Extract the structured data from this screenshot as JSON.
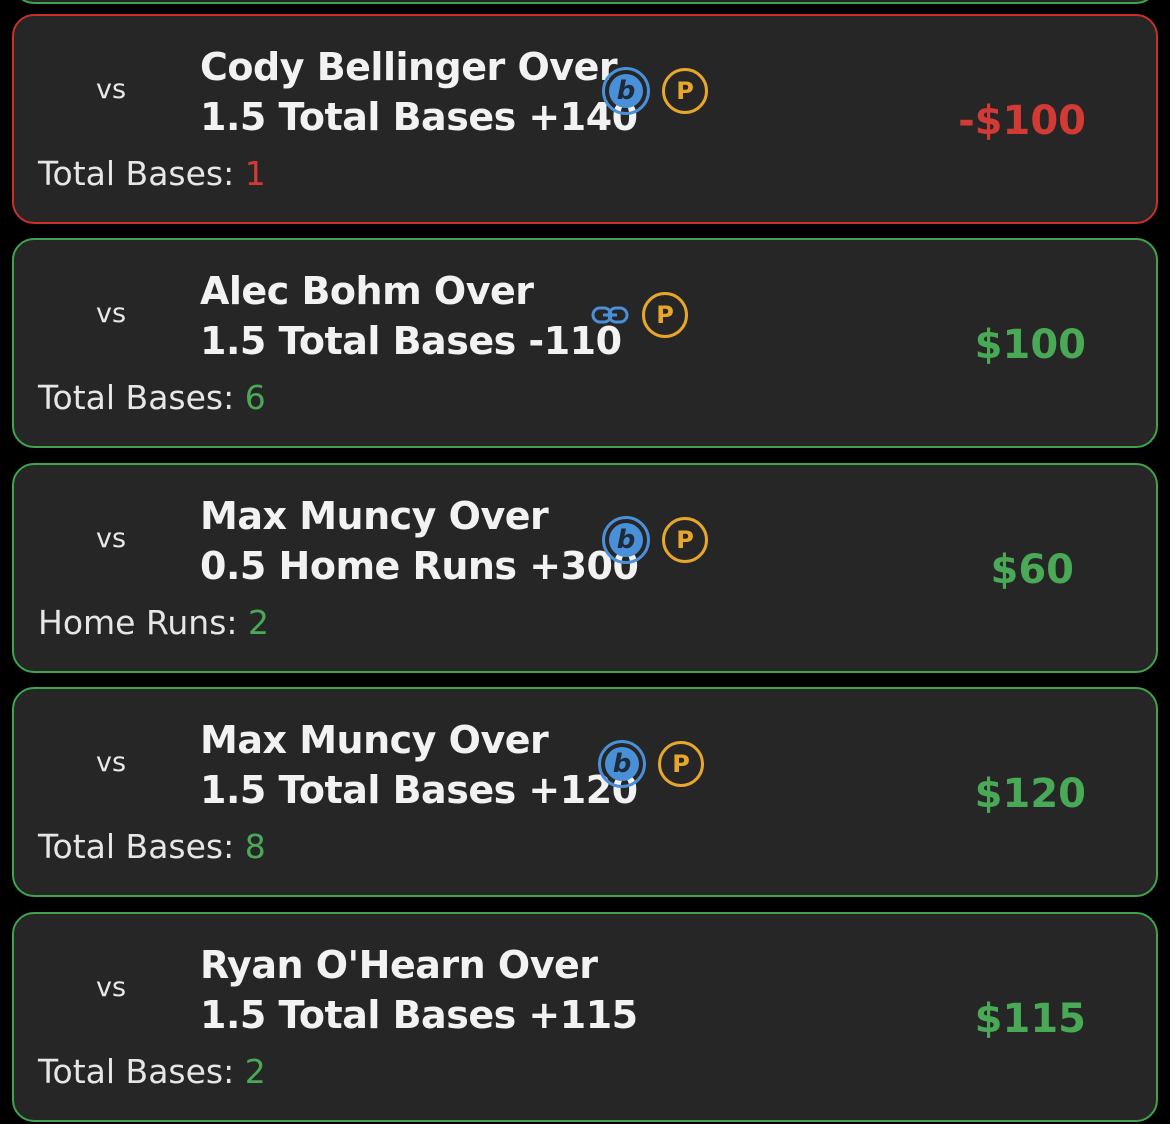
{
  "bets": [
    {
      "vs": "vs",
      "line1": "Cody Bellinger Over",
      "line2": "1.5 Total Bases +140",
      "stat_label": "Total Bases:",
      "stat_value": "1",
      "amount": "-$100",
      "result": "loss",
      "icons": [
        "b-badge-icon",
        "p-badge-icon"
      ]
    },
    {
      "vs": "vs",
      "line1": "Alec Bohm Over",
      "line2": "1.5 Total Bases -110",
      "stat_label": "Total Bases:",
      "stat_value": "6",
      "amount": "$100",
      "result": "win",
      "icons": [
        "link-icon",
        "p-badge-icon"
      ]
    },
    {
      "vs": "vs",
      "line1": "Max Muncy Over",
      "line2": "0.5 Home Runs +300",
      "stat_label": "Home Runs:",
      "stat_value": "2",
      "amount": "$60",
      "result": "win",
      "icons": [
        "b-badge-icon",
        "p-badge-icon"
      ]
    },
    {
      "vs": "vs",
      "line1": "Max Muncy Over",
      "line2": "1.5 Total Bases +120",
      "stat_label": "Total Bases:",
      "stat_value": "8",
      "amount": "$120",
      "result": "win",
      "icons": [
        "b-badge-icon",
        "p-badge-icon"
      ]
    },
    {
      "vs": "vs",
      "line1": "Ryan O'Hearn Over",
      "line2": "1.5 Total Bases +115",
      "stat_label": "Total Bases:",
      "stat_value": "2",
      "amount": "$115",
      "result": "win",
      "icons": []
    }
  ],
  "badges": {
    "b": "b",
    "p": "P"
  },
  "colors": {
    "win": "#49a957",
    "loss": "#d23a35",
    "card_bg": "#262626",
    "b_badge": "#4a90d9",
    "p_badge": "#e6a72a"
  }
}
